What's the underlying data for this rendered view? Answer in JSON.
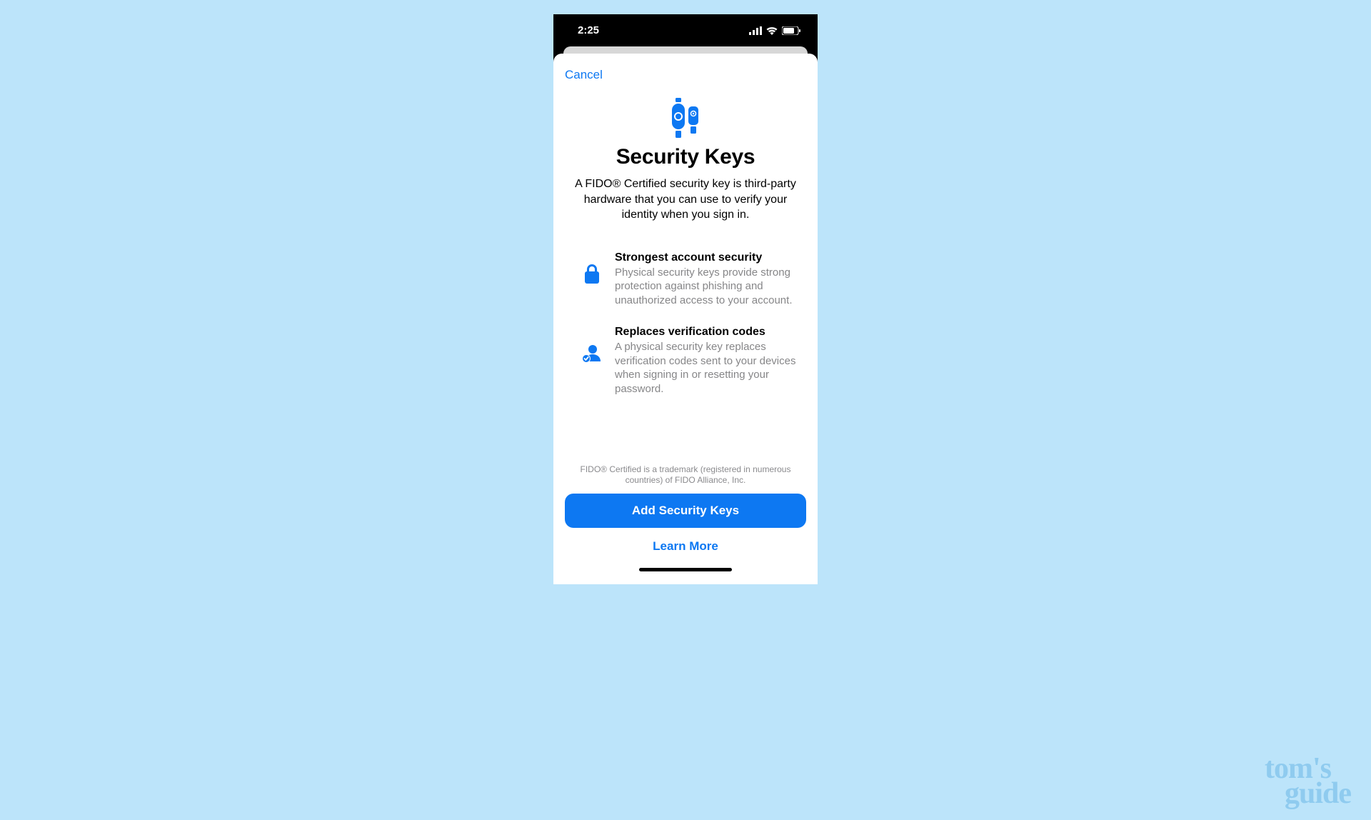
{
  "status": {
    "time": "2:25"
  },
  "sheet": {
    "cancel_label": "Cancel",
    "hero_title": "Security Keys",
    "hero_subtitle": "A FIDO® Certified security key is third-party hardware that you can use to verify your identity when you sign in.",
    "features": [
      {
        "title": "Strongest account security",
        "description": "Physical security keys provide strong protection against phishing and unauthorized access to your account."
      },
      {
        "title": "Replaces verification codes",
        "description": "A physical security key replaces verification codes sent to your devices when signing in or resetting your password."
      }
    ],
    "trademark": "FIDO® Certified is a trademark (registered in numerous countries) of FIDO Alliance, Inc.",
    "primary_button": "Add Security Keys",
    "learn_more": "Learn More"
  },
  "watermark": {
    "line1": "tom's",
    "line2": "guide"
  }
}
